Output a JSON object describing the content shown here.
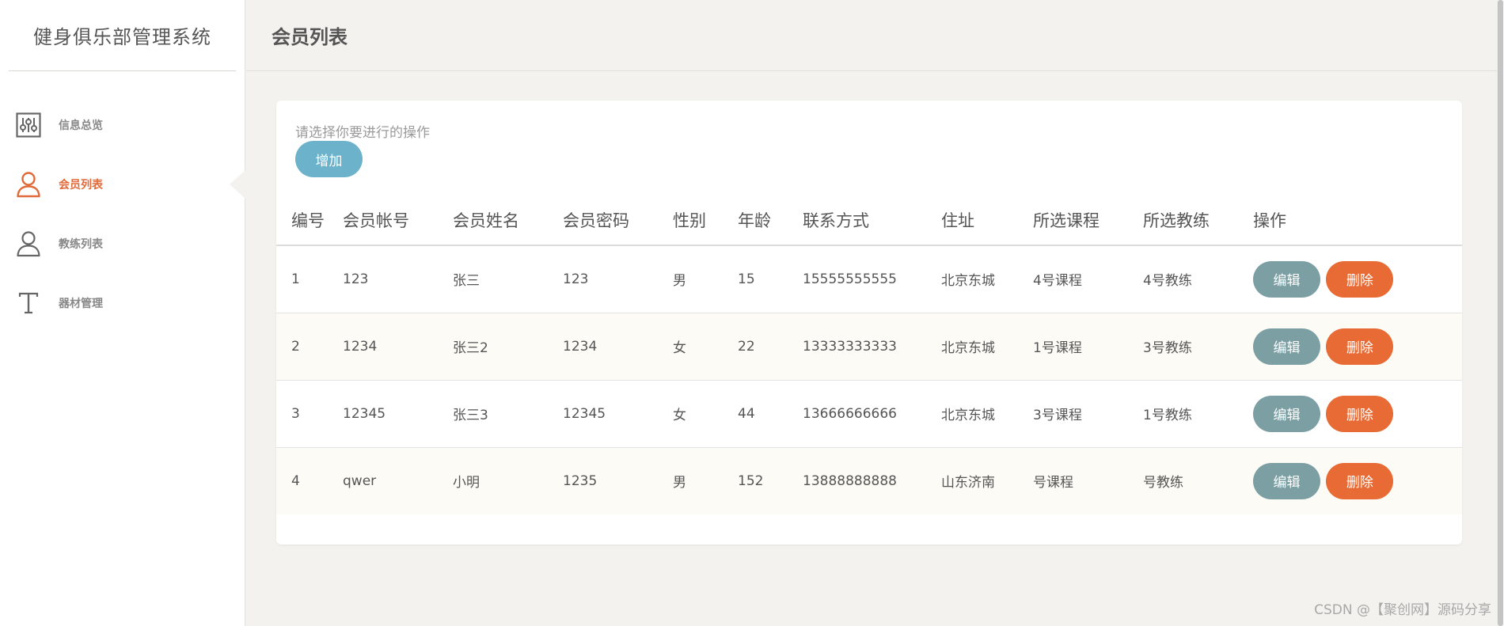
{
  "app": {
    "title": "健身俱乐部管理系统"
  },
  "sidebar": {
    "items": [
      {
        "label": "信息总览",
        "icon": "sliders-icon",
        "active": false
      },
      {
        "label": "会员列表",
        "icon": "user-icon",
        "active": true
      },
      {
        "label": "教练列表",
        "icon": "coach-icon",
        "active": false
      },
      {
        "label": "器材管理",
        "icon": "text-icon",
        "active": false
      }
    ]
  },
  "header": {
    "title": "会员列表"
  },
  "toolbar": {
    "prompt": "请选择你要进行的操作",
    "add_label": "增加"
  },
  "table": {
    "columns": [
      "编号",
      "会员帐号",
      "会员姓名",
      "会员密码",
      "性别",
      "年龄",
      "联系方式",
      "住址",
      "所选课程",
      "所选教练",
      "操作"
    ],
    "rows": [
      [
        "1",
        "123",
        "张三",
        "123",
        "男",
        "15",
        "15555555555",
        "北京东城",
        "4号课程",
        "4号教练"
      ],
      [
        "2",
        "1234",
        "张三2",
        "1234",
        "女",
        "22",
        "13333333333",
        "北京东城",
        "1号课程",
        "3号教练"
      ],
      [
        "3",
        "12345",
        "张三3",
        "12345",
        "女",
        "44",
        "13666666666",
        "北京东城",
        "3号课程",
        "1号教练"
      ],
      [
        "4",
        "qwer",
        "小明",
        "1235",
        "男",
        "152",
        "13888888888",
        "山东济南",
        "号课程",
        "号教练"
      ]
    ],
    "edit_label": "编辑",
    "delete_label": "删除"
  },
  "watermark": "CSDN @【聚创网】源码分享",
  "colors": {
    "accent": "#e06a3a",
    "add_button": "#6db2cb",
    "edit_button": "#7b9fa3",
    "delete_button": "#e86a34",
    "background": "#f3f2ef"
  }
}
